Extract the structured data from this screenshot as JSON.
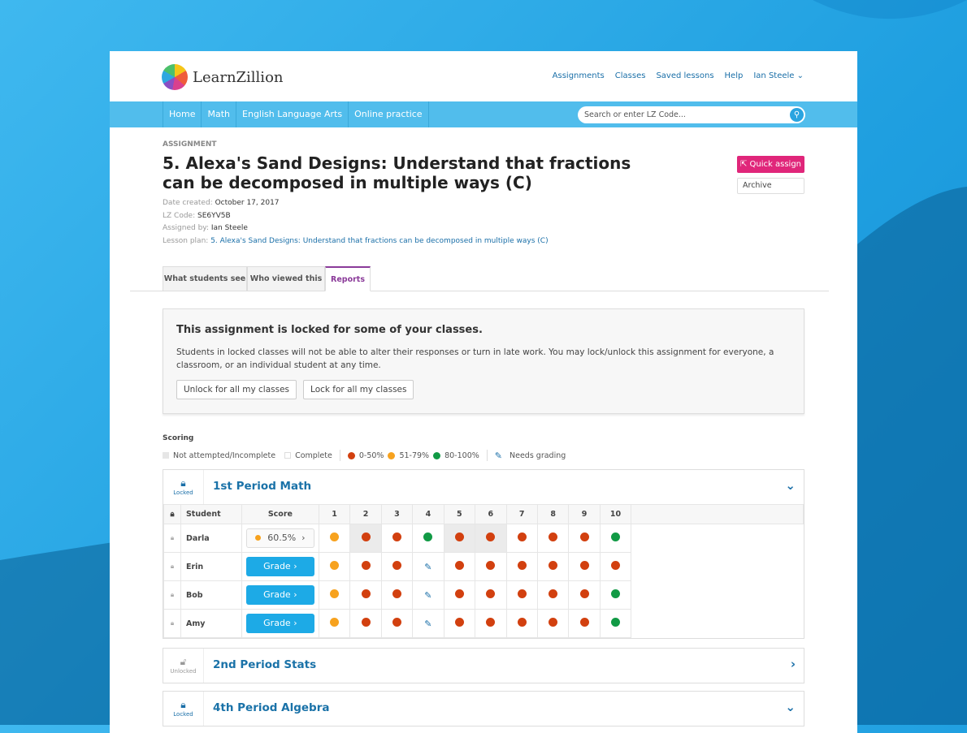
{
  "colors": {
    "accent": "#1daae6",
    "quick_assign": "#e0267a",
    "red": "#d2400f",
    "orange": "#f7a21e",
    "green": "#119a45",
    "tab_active": "#8a3a99"
  },
  "logo": {
    "text": "LearnZillion"
  },
  "topnav": [
    "Assignments",
    "Classes",
    "Saved lessons",
    "Help",
    "Ian Steele ⌄"
  ],
  "navbar": {
    "items": [
      "Home",
      "Math",
      "English Language Arts",
      "Online practice"
    ],
    "search_placeholder": "Search or enter LZ Code..."
  },
  "assignment": {
    "eyebrow": "ASSIGNMENT",
    "title": "5. Alexa's Sand Designs: Understand that fractions can be decomposed in multiple ways (C)",
    "date_label": "Date created:",
    "date": "October 17, 2017",
    "code_label": "LZ Code:",
    "code": "SE6YV5B",
    "by_label": "Assigned by:",
    "by": "Ian Steele",
    "plan_label": "Lesson plan:",
    "plan": "5. Alexa's Sand Designs: Understand that fractions can be decomposed in multiple ways (C)",
    "quick_assign": "Quick assign",
    "archive": "Archive"
  },
  "tabs": [
    "What students see",
    "Who viewed this",
    "Reports"
  ],
  "lock_notice": {
    "title": "This assignment is locked for some of your classes.",
    "body": "Students in locked classes will not be able to alter their responses or turn in late work. You may lock/unlock this assignment for everyone, a classroom, or an individual student at any time.",
    "unlock": "Unlock for all my classes",
    "lock": "Lock for all my classes"
  },
  "scoring": {
    "title": "Scoring",
    "not_attempted": "Not attempted/Incomplete",
    "complete": "Complete",
    "low": "0-50%",
    "mid": "51-79%",
    "high": "80-100%",
    "needs_grading": "Needs grading"
  },
  "classes": [
    {
      "name": "1st Period Math",
      "status": "Locked",
      "expanded": true,
      "headers": {
        "student": "Student",
        "score": "Score",
        "questions": [
          "1",
          "2",
          "3",
          "4",
          "5",
          "6",
          "7",
          "8",
          "9",
          "10"
        ]
      },
      "students": [
        {
          "name": "Darla",
          "score": "60.5%",
          "score_color": "orange",
          "grade_label": null,
          "cells": [
            "o",
            "r",
            "r",
            "g",
            "r",
            "r",
            "r",
            "r",
            "r",
            "g"
          ],
          "incomplete": [
            1,
            4,
            5
          ]
        },
        {
          "name": "Erin",
          "score": null,
          "grade_label": "Grade",
          "cells": [
            "o",
            "r",
            "r",
            "p",
            "r",
            "r",
            "r",
            "r",
            "r",
            "r"
          ],
          "incomplete": []
        },
        {
          "name": "Bob",
          "score": null,
          "grade_label": "Grade",
          "cells": [
            "o",
            "r",
            "r",
            "p",
            "r",
            "r",
            "r",
            "r",
            "r",
            "g"
          ],
          "incomplete": []
        },
        {
          "name": "Amy",
          "score": null,
          "grade_label": "Grade",
          "cells": [
            "o",
            "r",
            "r",
            "p",
            "r",
            "r",
            "r",
            "r",
            "r",
            "g"
          ],
          "incomplete": []
        }
      ]
    },
    {
      "name": "2nd Period Stats",
      "status": "Unlocked",
      "expanded": false
    },
    {
      "name": "4th Period Algebra",
      "status": "Locked",
      "expanded": true
    }
  ]
}
